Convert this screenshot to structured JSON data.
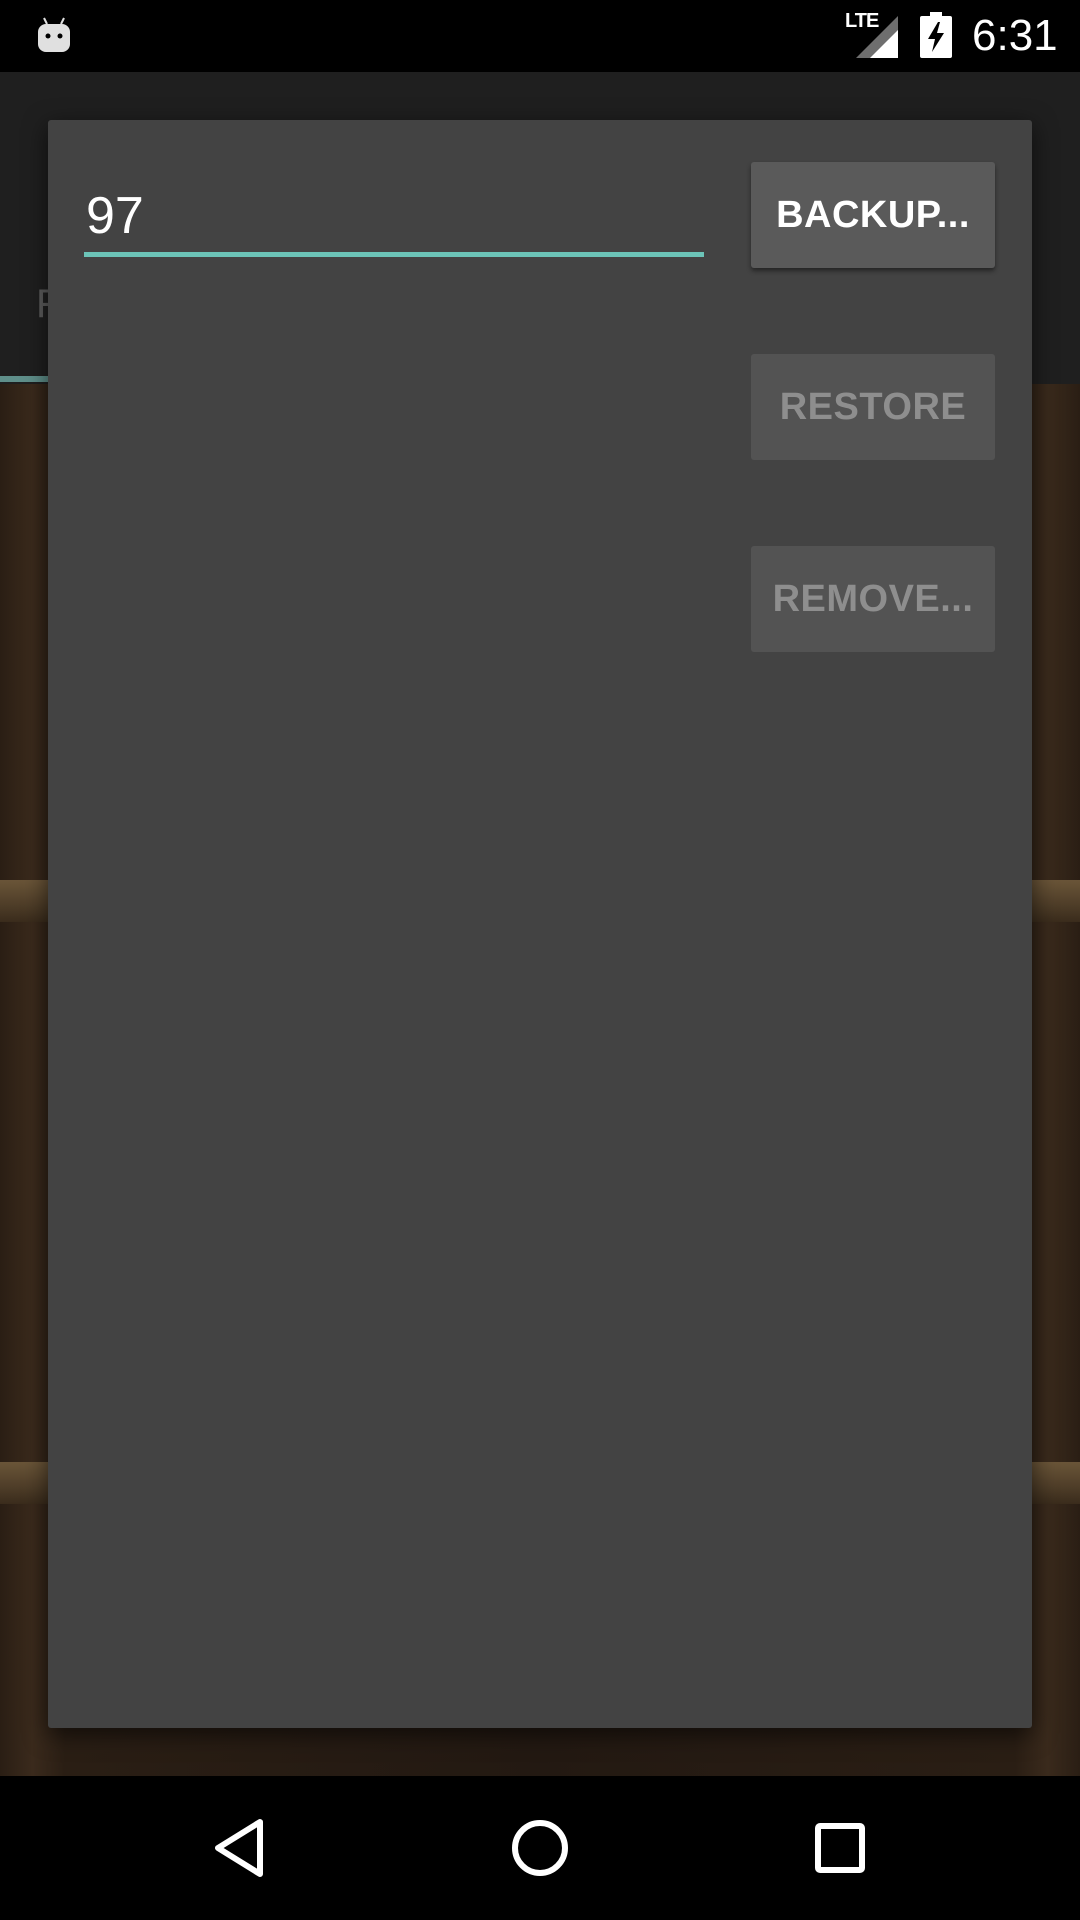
{
  "status_bar": {
    "network_label": "LTE",
    "time": "6:31",
    "icons": [
      "android-notification-icon",
      "signal-icon",
      "battery-charging-icon"
    ]
  },
  "background_app": {
    "tab_letter": "F"
  },
  "dialog": {
    "name_input": {
      "value": "97",
      "placeholder": ""
    },
    "buttons": {
      "backup_label": "BACKUP...",
      "restore_label": "RESTORE",
      "remove_label": "REMOVE..."
    },
    "accent_color": "#6cc4b8"
  },
  "nav_bar": {
    "icons": [
      "back-icon",
      "home-icon",
      "recents-icon"
    ]
  }
}
